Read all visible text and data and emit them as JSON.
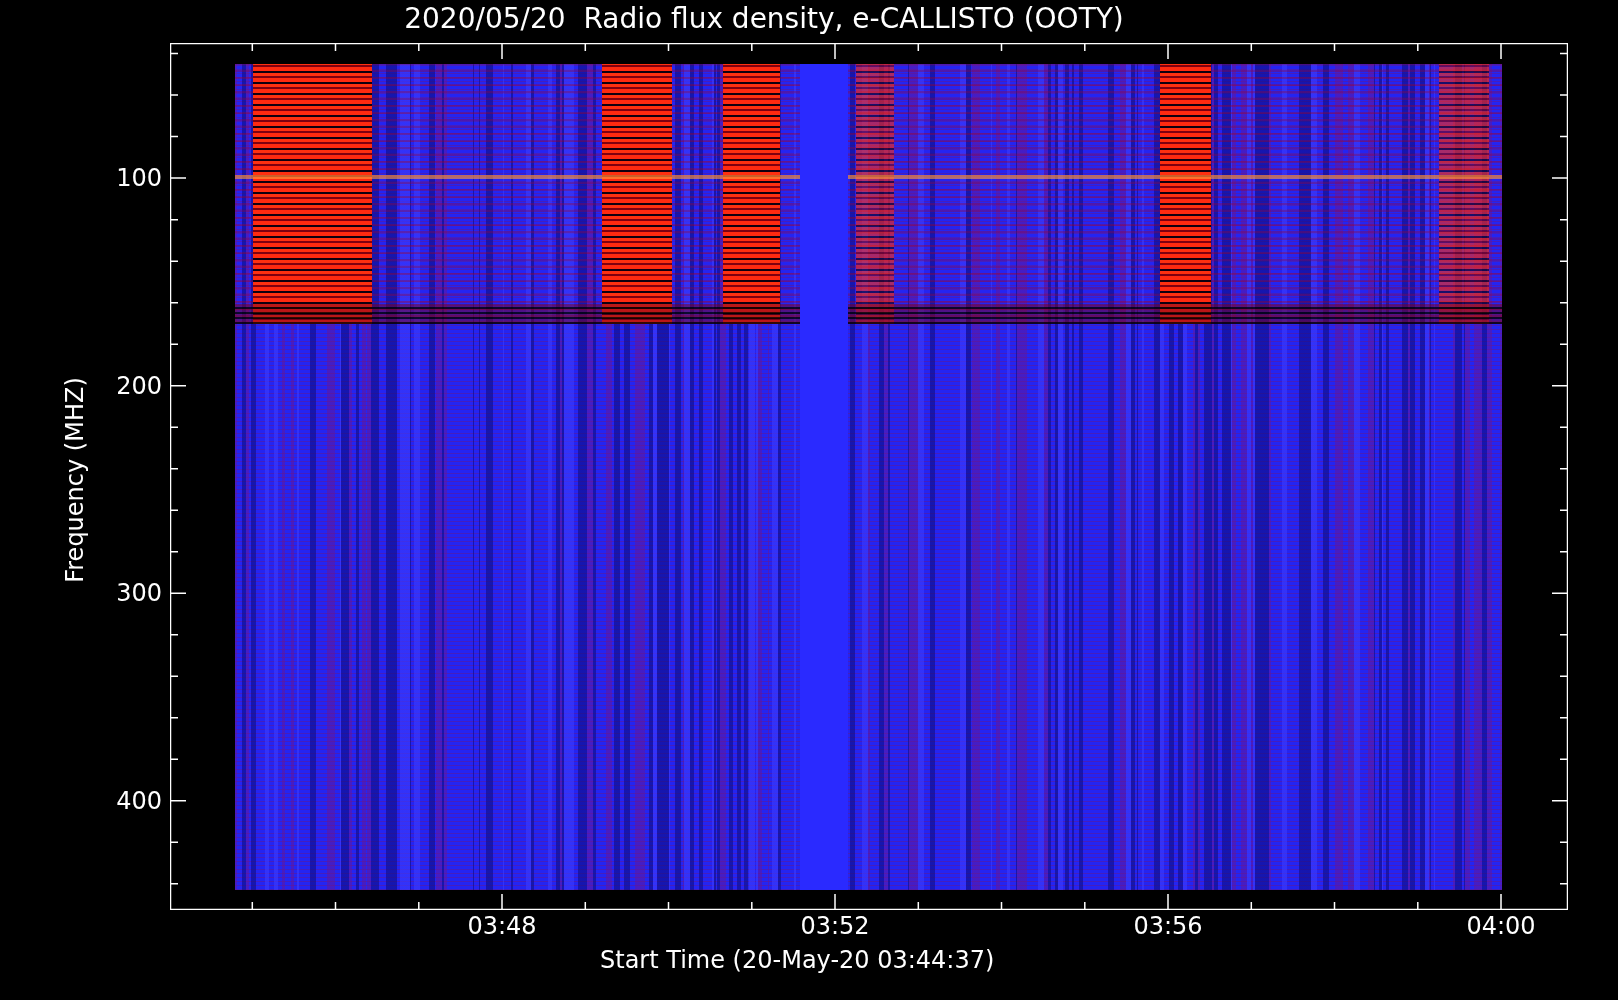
{
  "title": "2020/05/20  Radio flux density, e-CALLISTO (OOTY)",
  "y_axis": {
    "label": "Frequency (MHZ)",
    "ticks": [
      "100",
      "200",
      "300",
      "400"
    ]
  },
  "x_axis": {
    "label": "Start Time (20-May-20 03:44:37)",
    "ticks": [
      "03:48",
      "03:52",
      "03:56",
      "04:00"
    ]
  }
}
